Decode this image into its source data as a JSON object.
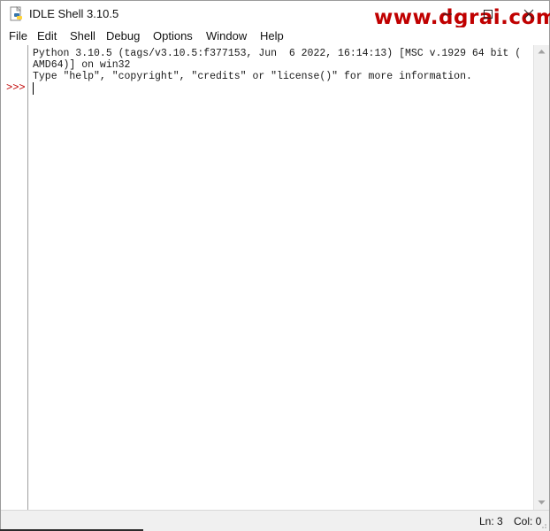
{
  "window": {
    "title": "IDLE Shell 3.10.5",
    "watermark": "www.dgrai.com"
  },
  "menu": {
    "items": [
      "File",
      "Edit",
      "Shell",
      "Debug",
      "Options",
      "Window",
      "Help"
    ]
  },
  "shell": {
    "lines": [
      "Python 3.10.5 (tags/v3.10.5:f377153, Jun  6 2022, 16:14:13) [MSC v.1929 64 bit (",
      "AMD64)] on win32",
      "Type \"help\", \"copyright\", \"credits\" or \"license()\" for more information."
    ],
    "prompt": ">>>"
  },
  "status": {
    "line": "Ln: 3",
    "col": "Col: 0"
  },
  "colors": {
    "prompt": "#c00000",
    "watermark": "#c00000"
  }
}
